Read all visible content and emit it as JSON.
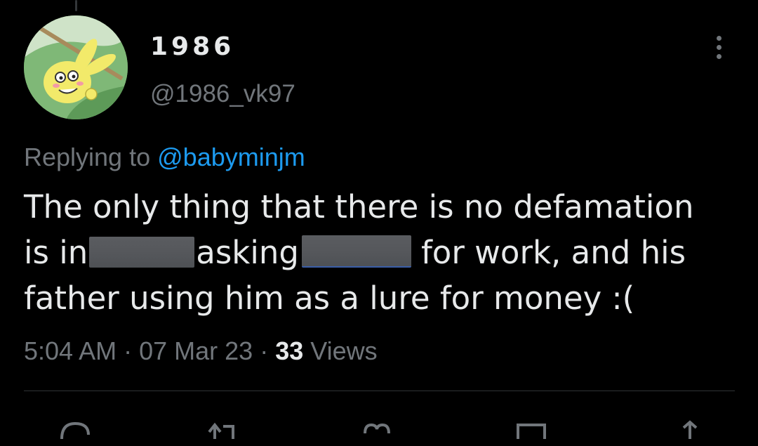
{
  "tweet": {
    "display_name": "1986",
    "handle": "@1986_vk97",
    "reply_prefix": "Replying to",
    "reply_to": "@babyminjm",
    "text_line1": "The only thing that there is no defamation",
    "text_line2_a": "is in",
    "text_line2_b": "asking",
    "text_line2_c": "for work, and his",
    "text_line3": "father using him as a lure for money :(",
    "time": "5:04 AM",
    "separator": " · ",
    "date": "07 Mar 23",
    "views_count": "33",
    "views_label": "Views"
  },
  "icons": {
    "more": "more-dots-icon",
    "reply": "reply-icon",
    "retweet": "retweet-icon",
    "like": "heart-icon",
    "bookmark": "bookmark-icon",
    "share": "share-icon"
  },
  "colors": {
    "background": "#000000",
    "text_primary": "#e7e9ea",
    "text_secondary": "#71767b",
    "link": "#1d9bf0",
    "divider": "#2f3336"
  }
}
